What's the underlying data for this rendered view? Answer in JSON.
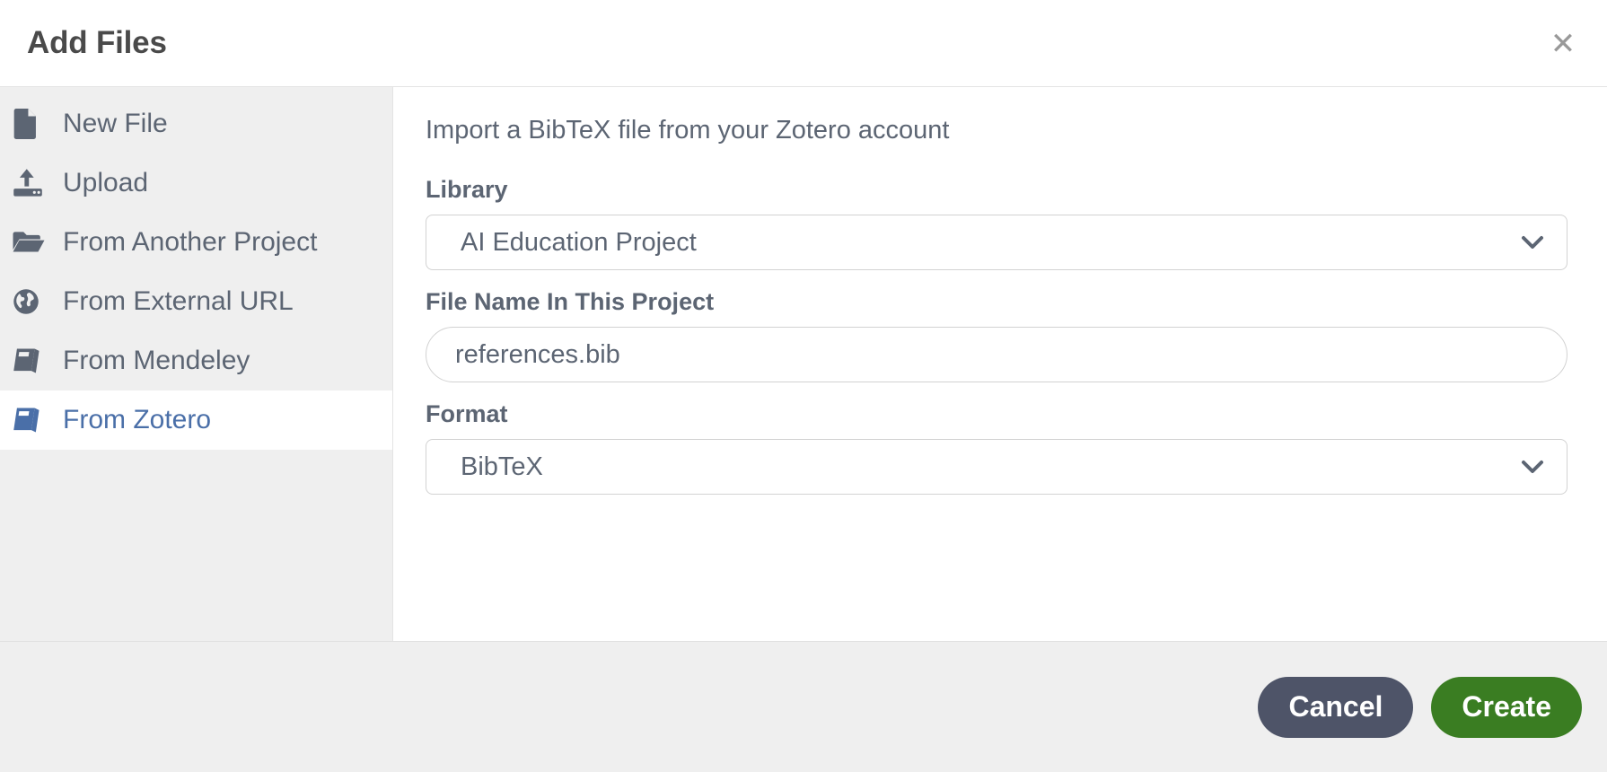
{
  "header": {
    "title": "Add Files",
    "close_icon": "close-icon",
    "close_glyph": "✕"
  },
  "sidebar": {
    "items": [
      {
        "label": "New File",
        "icon": "file-icon",
        "active": false
      },
      {
        "label": "Upload",
        "icon": "upload-icon",
        "active": false
      },
      {
        "label": "From Another Project",
        "icon": "open-folder-icon",
        "active": false
      },
      {
        "label": "From External URL",
        "icon": "globe-icon",
        "active": false
      },
      {
        "label": "From Mendeley",
        "icon": "book-icon",
        "active": false
      },
      {
        "label": "From Zotero",
        "icon": "book-icon",
        "active": true
      }
    ]
  },
  "content": {
    "intro": "Import a BibTeX file from your Zotero account",
    "fields": {
      "library": {
        "label": "Library",
        "value": "AI Education Project",
        "options": [
          "AI Education Project"
        ],
        "chevron_icon": "chevron-down-icon"
      },
      "file_name": {
        "label": "File Name In This Project",
        "value": "references.bib",
        "placeholder": "references.bib"
      },
      "format": {
        "label": "Format",
        "value": "BibTeX",
        "options": [
          "BibTeX"
        ],
        "chevron_icon": "chevron-down-icon"
      }
    }
  },
  "footer": {
    "cancel_label": "Cancel",
    "create_label": "Create"
  },
  "colors": {
    "sidebar_bg": "#efefef",
    "footer_bg": "#efefef",
    "text": "#5c6573",
    "active_text": "#4a6fa8",
    "cancel_bg": "#4e5468",
    "create_bg": "#3a7d22",
    "border": "#d2d2d2"
  }
}
